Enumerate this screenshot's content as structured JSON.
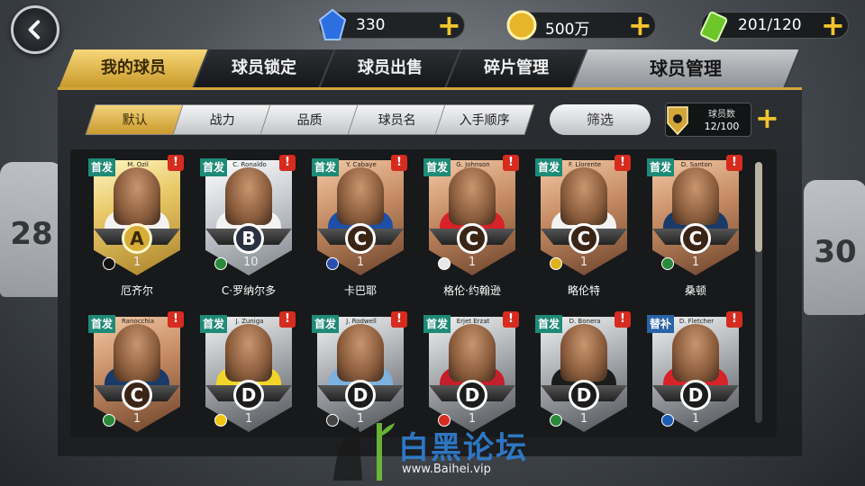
{
  "resources": [
    {
      "name": "gem",
      "value": "330",
      "color": "#2c6fe0"
    },
    {
      "name": "coin",
      "value": "500万",
      "color": "#e6b52a"
    },
    {
      "name": "energy",
      "value": "201/120",
      "color": "#6fc62b"
    }
  ],
  "tabs": [
    "我的球员",
    "球员锁定",
    "球员出售",
    "碎片管理",
    "球员管理"
  ],
  "active_tab": 0,
  "sort_buttons": [
    "默认",
    "战力",
    "品质",
    "球员名",
    "入手顺序"
  ],
  "filter_label": "筛选",
  "player_count": {
    "label": "球员数",
    "value": "12/100"
  },
  "background_numbers": [
    "28",
    "30"
  ],
  "players": [
    {
      "en": "M. Ozil",
      "cn": "厄齐尔",
      "grade": "A",
      "status": "首发",
      "level": "1",
      "flag": "#111111",
      "shirt": "#f2f2f2"
    },
    {
      "en": "C. Ronaldo",
      "cn": "C·罗纳尔多",
      "grade": "B",
      "status": "首发",
      "level": "10",
      "flag": "#2a8a3a",
      "shirt": "#f2f2f2"
    },
    {
      "en": "Y. Cabaye",
      "cn": "卡巴耶",
      "grade": "C",
      "status": "首发",
      "level": "1",
      "flag": "#2a4db0",
      "shirt": "#1d4fa8"
    },
    {
      "en": "G. Johnson",
      "cn": "格伦·约翰逊",
      "grade": "C",
      "status": "首发",
      "level": "1",
      "flag": "#e8e8e8",
      "shirt": "#d8222a"
    },
    {
      "en": "F. Llorente",
      "cn": "略伦特",
      "grade": "C",
      "status": "首发",
      "level": "1",
      "flag": "#e0b21b",
      "shirt": "#f2f2f2"
    },
    {
      "en": "D. Santon",
      "cn": "桑顿",
      "grade": "C",
      "status": "首发",
      "level": "1",
      "flag": "#2a8a3a",
      "shirt": "#1a3a6a"
    },
    {
      "en": "Ranocchia",
      "cn": "",
      "grade": "C",
      "status": "首发",
      "level": "1",
      "flag": "#2a8a3a",
      "shirt": "#1a3a6a"
    },
    {
      "en": "J. Zuniga",
      "cn": "",
      "grade": "D",
      "status": "首发",
      "level": "1",
      "flag": "#f1c40f",
      "shirt": "#f1d52a"
    },
    {
      "en": "J. Rodwell",
      "cn": "",
      "grade": "D",
      "status": "首发",
      "level": "1",
      "flag": "#444444",
      "shirt": "#7bb2e0"
    },
    {
      "en": "Erjet Erzat",
      "cn": "",
      "grade": "D",
      "status": "首发",
      "level": "1",
      "flag": "#d62b1f",
      "shirt": "#c41f2b"
    },
    {
      "en": "D. Bonera",
      "cn": "",
      "grade": "D",
      "status": "首发",
      "level": "1",
      "flag": "#2a8a3a",
      "shirt": "#1c1c1c"
    },
    {
      "en": "D. Fletcher",
      "cn": "",
      "grade": "D",
      "status": "替补",
      "level": "1",
      "flag": "#1c5bb5",
      "shirt": "#d8222a"
    }
  ],
  "watermark": {
    "title": "白黑论坛",
    "url": "www.Baihei.vip"
  }
}
